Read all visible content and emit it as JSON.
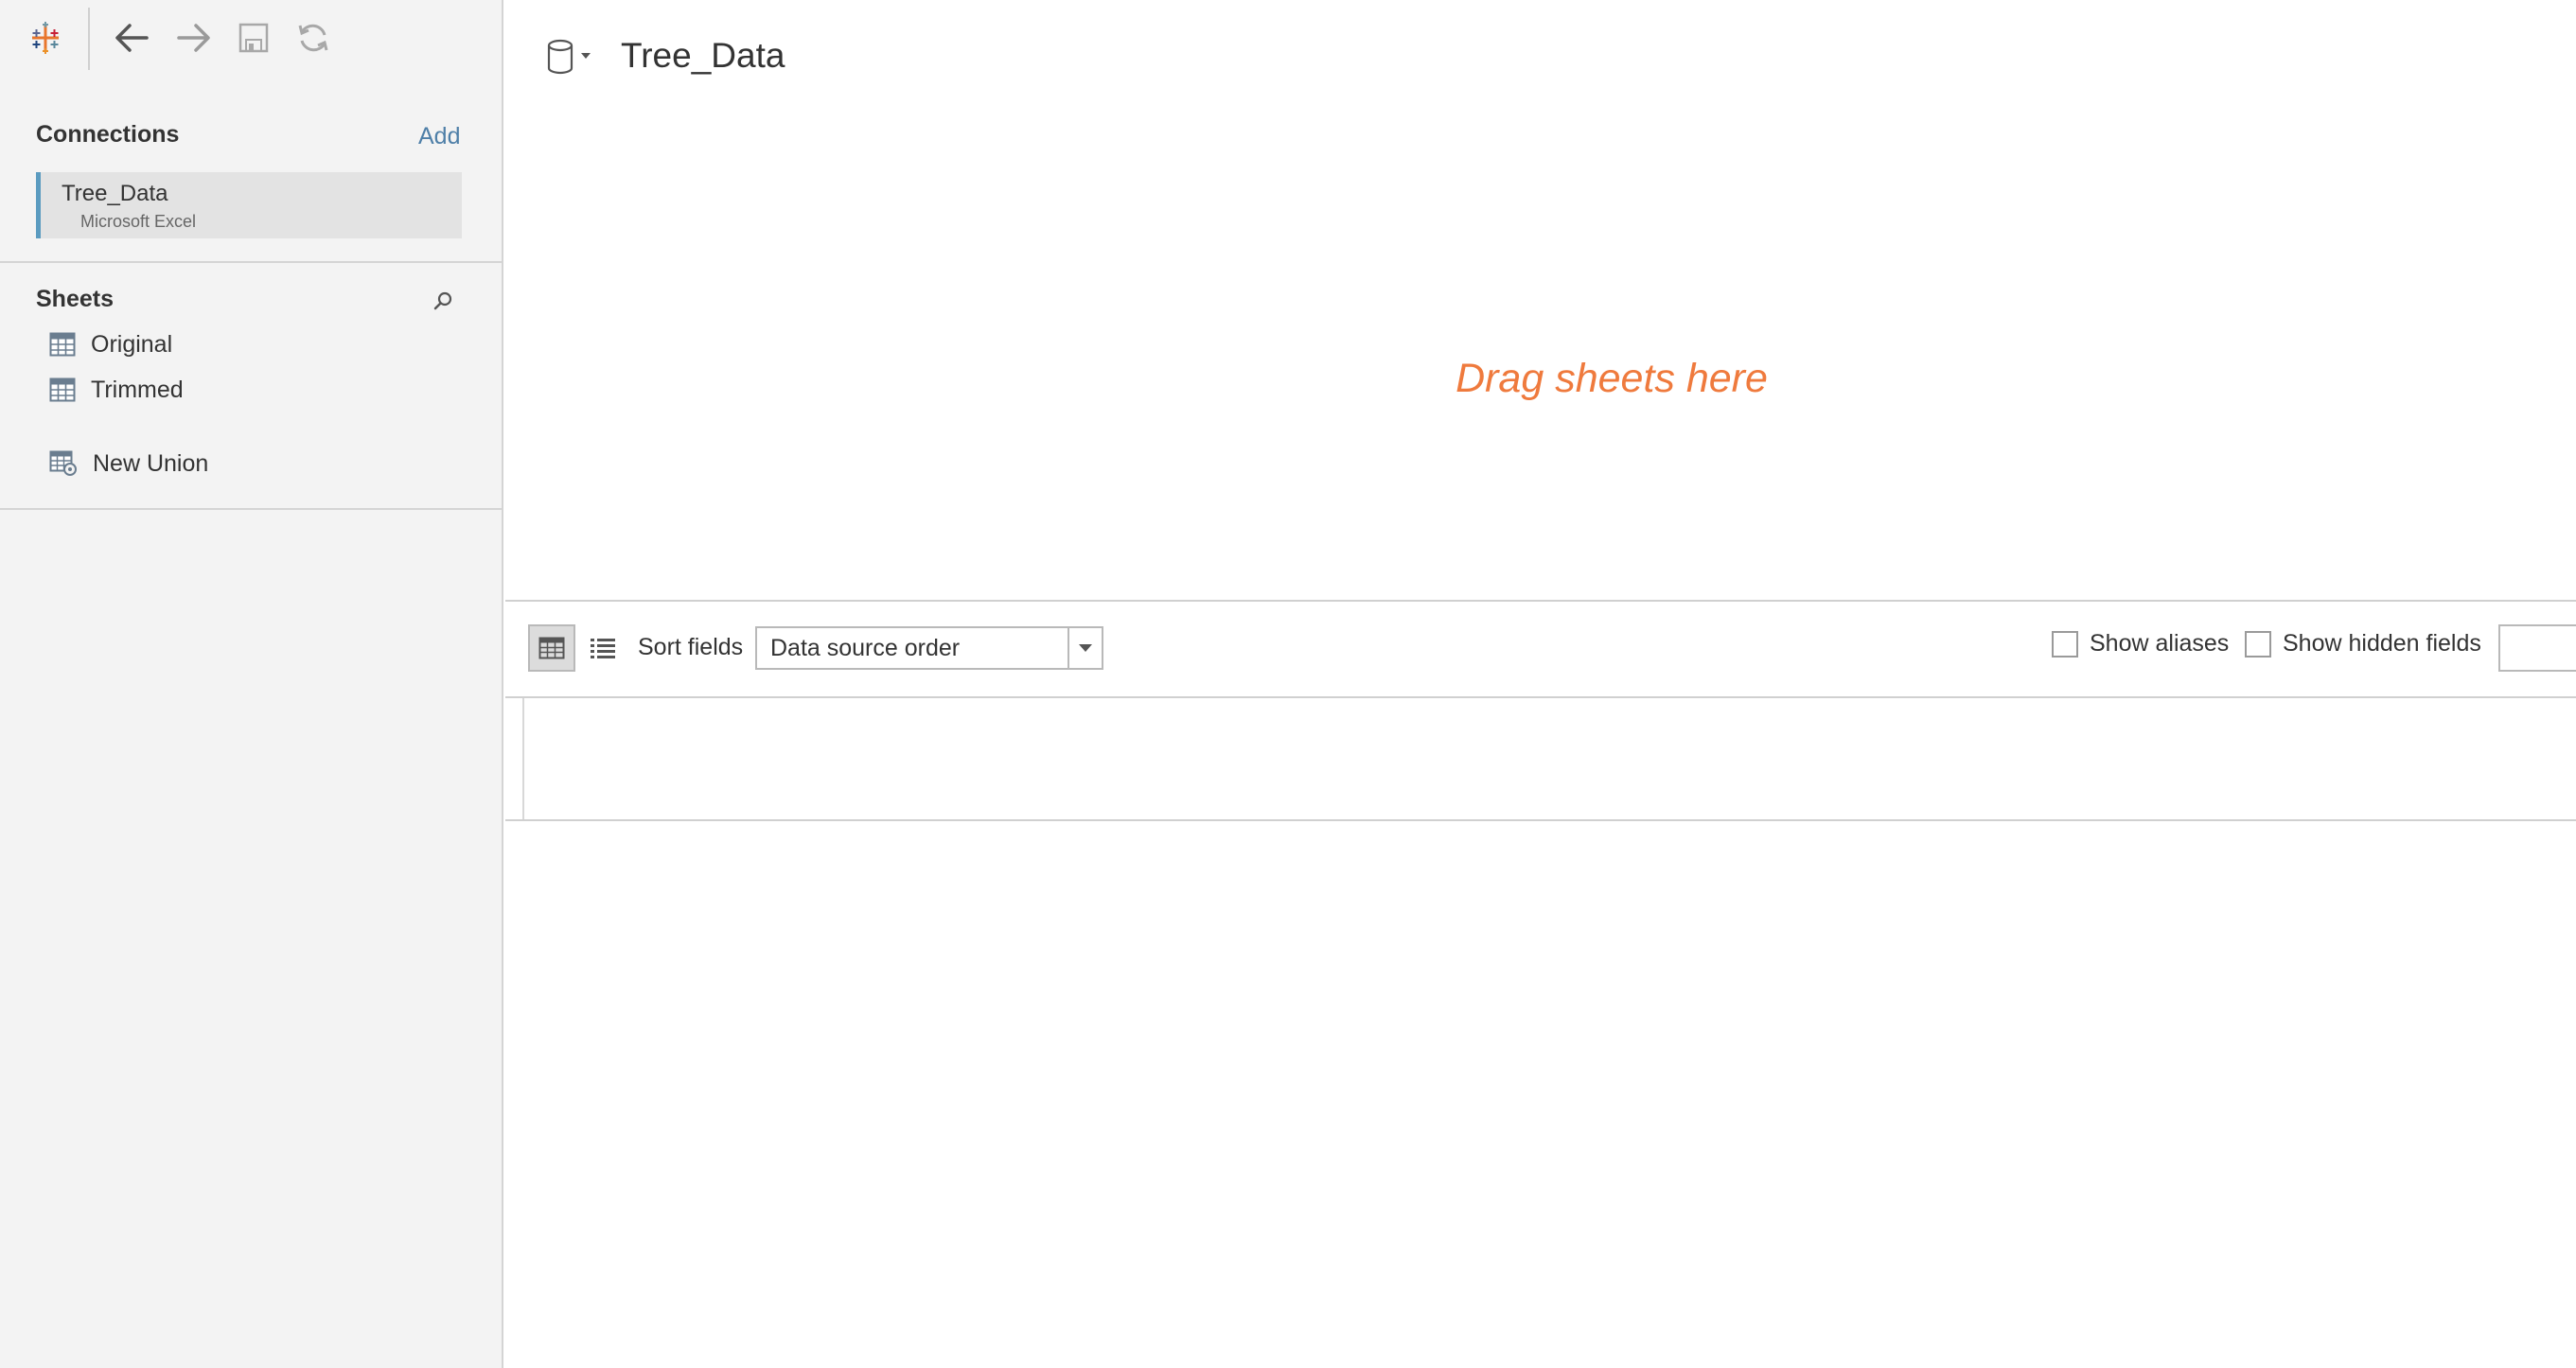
{
  "toolbar": {
    "icons": [
      "tableau-logo-icon",
      "back-arrow-icon",
      "forward-arrow-icon",
      "save-icon",
      "refresh-icon"
    ]
  },
  "connections": {
    "title": "Connections",
    "add_label": "Add",
    "items": [
      {
        "name": "Tree_Data",
        "type": "Microsoft Excel"
      }
    ]
  },
  "sheets": {
    "title": "Sheets",
    "items": [
      {
        "label": "Original",
        "icon": "table-icon"
      },
      {
        "label": "Trimmed",
        "icon": "table-icon"
      }
    ],
    "new_union": {
      "label": "New Union",
      "icon": "union-icon"
    }
  },
  "main": {
    "datasource_title": "Tree_Data",
    "drag_hint": "Drag sheets here",
    "sort_label": "Sort fields",
    "sort_selected": "Data source order",
    "show_aliases_label": "Show aliases",
    "show_hidden_label": "Show hidden fields",
    "show_aliases_checked": false,
    "show_hidden_checked": false
  },
  "colors": {
    "accent_blue": "#4e7fa8",
    "connection_bar": "#5b9bc0",
    "drag_hint": "#ef7a3d",
    "sidebar_bg": "#f3f3f3"
  }
}
